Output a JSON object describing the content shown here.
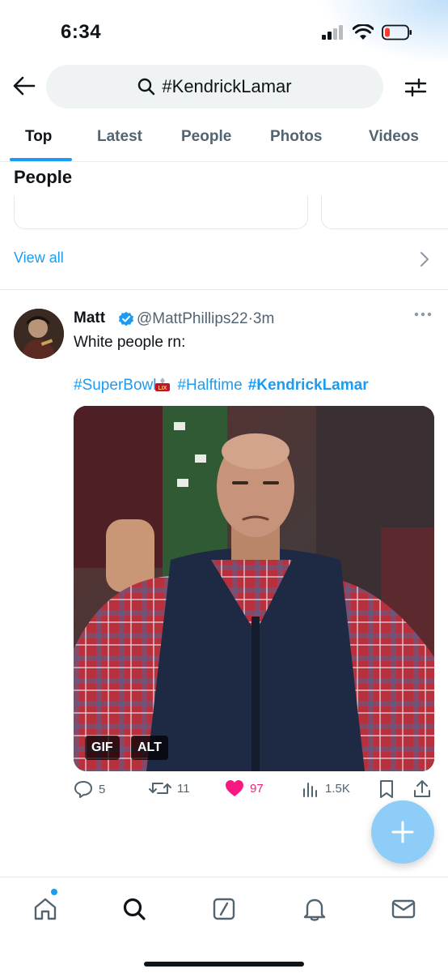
{
  "status_bar": {
    "time": "6:34"
  },
  "search": {
    "query": "#KendrickLamar"
  },
  "tabs": [
    {
      "label": "Top",
      "active": true
    },
    {
      "label": "Latest",
      "active": false
    },
    {
      "label": "People",
      "active": false
    },
    {
      "label": "Photos",
      "active": false
    },
    {
      "label": "Videos",
      "active": false
    }
  ],
  "people": {
    "title": "People",
    "view_all": "View all"
  },
  "tweet": {
    "name": "Matt",
    "handle": "@MattPhillips22",
    "time": "·3m",
    "text": "White people rn:",
    "hashtags": [
      "#SuperBowl",
      "#Halftime",
      "#KendrickLamar"
    ],
    "media_badges": [
      "GIF",
      "ALT"
    ],
    "actions": {
      "replies": "5",
      "retweets": "11",
      "likes": "97",
      "views": "1.5K"
    }
  },
  "colors": {
    "accent": "#1d9bf0",
    "like": "#f91880",
    "text_secondary": "#536471",
    "fab": "#8ecdf8"
  },
  "icons": {
    "back": "arrow-left-icon",
    "search": "search-icon",
    "filter": "filter-sliders-icon",
    "fab": "plus-icon",
    "nav": [
      "home-icon",
      "search-icon",
      "grok-icon",
      "notifications-icon",
      "messages-icon"
    ]
  }
}
